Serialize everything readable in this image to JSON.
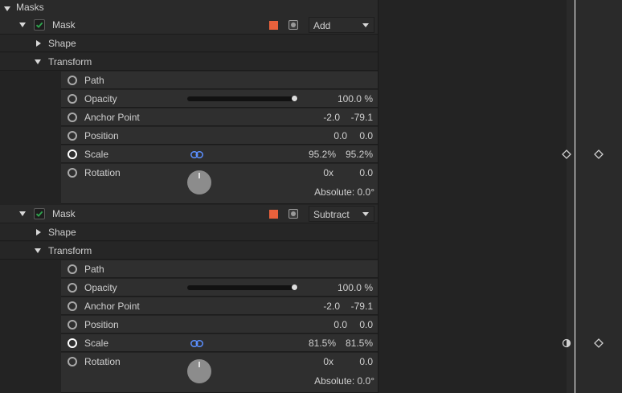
{
  "masks_header": "Masks",
  "masks": [
    {
      "label": "Mask",
      "color": "#e8613c",
      "mode": "Add",
      "shape_label": "Shape",
      "transform_label": "Transform",
      "props": {
        "path": "Path",
        "opacity": "Opacity",
        "opacity_value": "100.0 %",
        "opacity_level": 1.0,
        "anchor": "Anchor Point",
        "anchor_x": "-2.0",
        "anchor_y": "-79.1",
        "position": "Position",
        "position_x": "0.0",
        "position_y": "0.0",
        "scale": "Scale",
        "scale_x": "95.2%",
        "scale_y": "95.2%",
        "rotation": "Rotation",
        "rotation_turns": "0x",
        "rotation_deg": "0.0",
        "rotation_absolute": "Absolute: 0.0°"
      }
    },
    {
      "label": "Mask",
      "color": "#e8613c",
      "mode": "Subtract",
      "shape_label": "Shape",
      "transform_label": "Transform",
      "props": {
        "path": "Path",
        "opacity": "Opacity",
        "opacity_value": "100.0 %",
        "opacity_level": 1.0,
        "anchor": "Anchor Point",
        "anchor_x": "-2.0",
        "anchor_y": "-79.1",
        "position": "Position",
        "position_x": "0.0",
        "position_y": "0.0",
        "scale": "Scale",
        "scale_x": "81.5%",
        "scale_y": "81.5%",
        "rotation": "Rotation",
        "rotation_turns": "0x",
        "rotation_deg": "0.0",
        "rotation_absolute": "Absolute: 0.0°"
      }
    }
  ],
  "icons": {
    "expand": "triangle-down-icon",
    "collapse": "triangle-right-icon",
    "enable": "checkbox-check-icon",
    "stopwatch": "stopwatch-icon",
    "link": "chain-link-icon",
    "dial": "rotation-dial-icon",
    "keyframe": "keyframe-diamond-icon"
  },
  "colors": {
    "accent_green": "#2fa84f",
    "link_blue": "#5b8fff",
    "playhead": "#ffffff"
  }
}
